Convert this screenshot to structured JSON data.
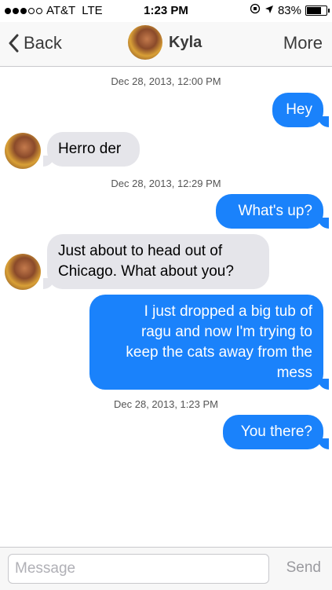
{
  "status_bar": {
    "carrier": "AT&T",
    "network": "LTE",
    "time": "1:23 PM",
    "battery_percent": "83%",
    "battery_level": 0.83,
    "signal_bars": 3
  },
  "nav": {
    "back_label": "Back",
    "contact_name": "Kyla",
    "more_label": "More"
  },
  "messages": [
    {
      "kind": "timestamp",
      "text": "Dec 28, 2013, 12:00 PM"
    },
    {
      "kind": "outgoing",
      "text": "Hey"
    },
    {
      "kind": "incoming",
      "text": "Herro der"
    },
    {
      "kind": "timestamp",
      "text": "Dec 28, 2013, 12:29 PM"
    },
    {
      "kind": "outgoing",
      "text": "What's up?"
    },
    {
      "kind": "incoming",
      "lines": [
        "Just about to head out of",
        "Chicago. What about you?"
      ]
    },
    {
      "kind": "outgoing",
      "lines": [
        "I just dropped a big tub of",
        "ragu and now I'm trying to",
        "keep the cats away from the",
        "mess"
      ]
    },
    {
      "kind": "timestamp",
      "text": "Dec 28, 2013, 1:23 PM"
    },
    {
      "kind": "outgoing",
      "text": "You there?"
    }
  ],
  "composer": {
    "placeholder": "Message",
    "send_label": "Send"
  },
  "colors": {
    "outgoing_bubble": "#1a82fb",
    "incoming_bubble": "#e5e5ea"
  }
}
